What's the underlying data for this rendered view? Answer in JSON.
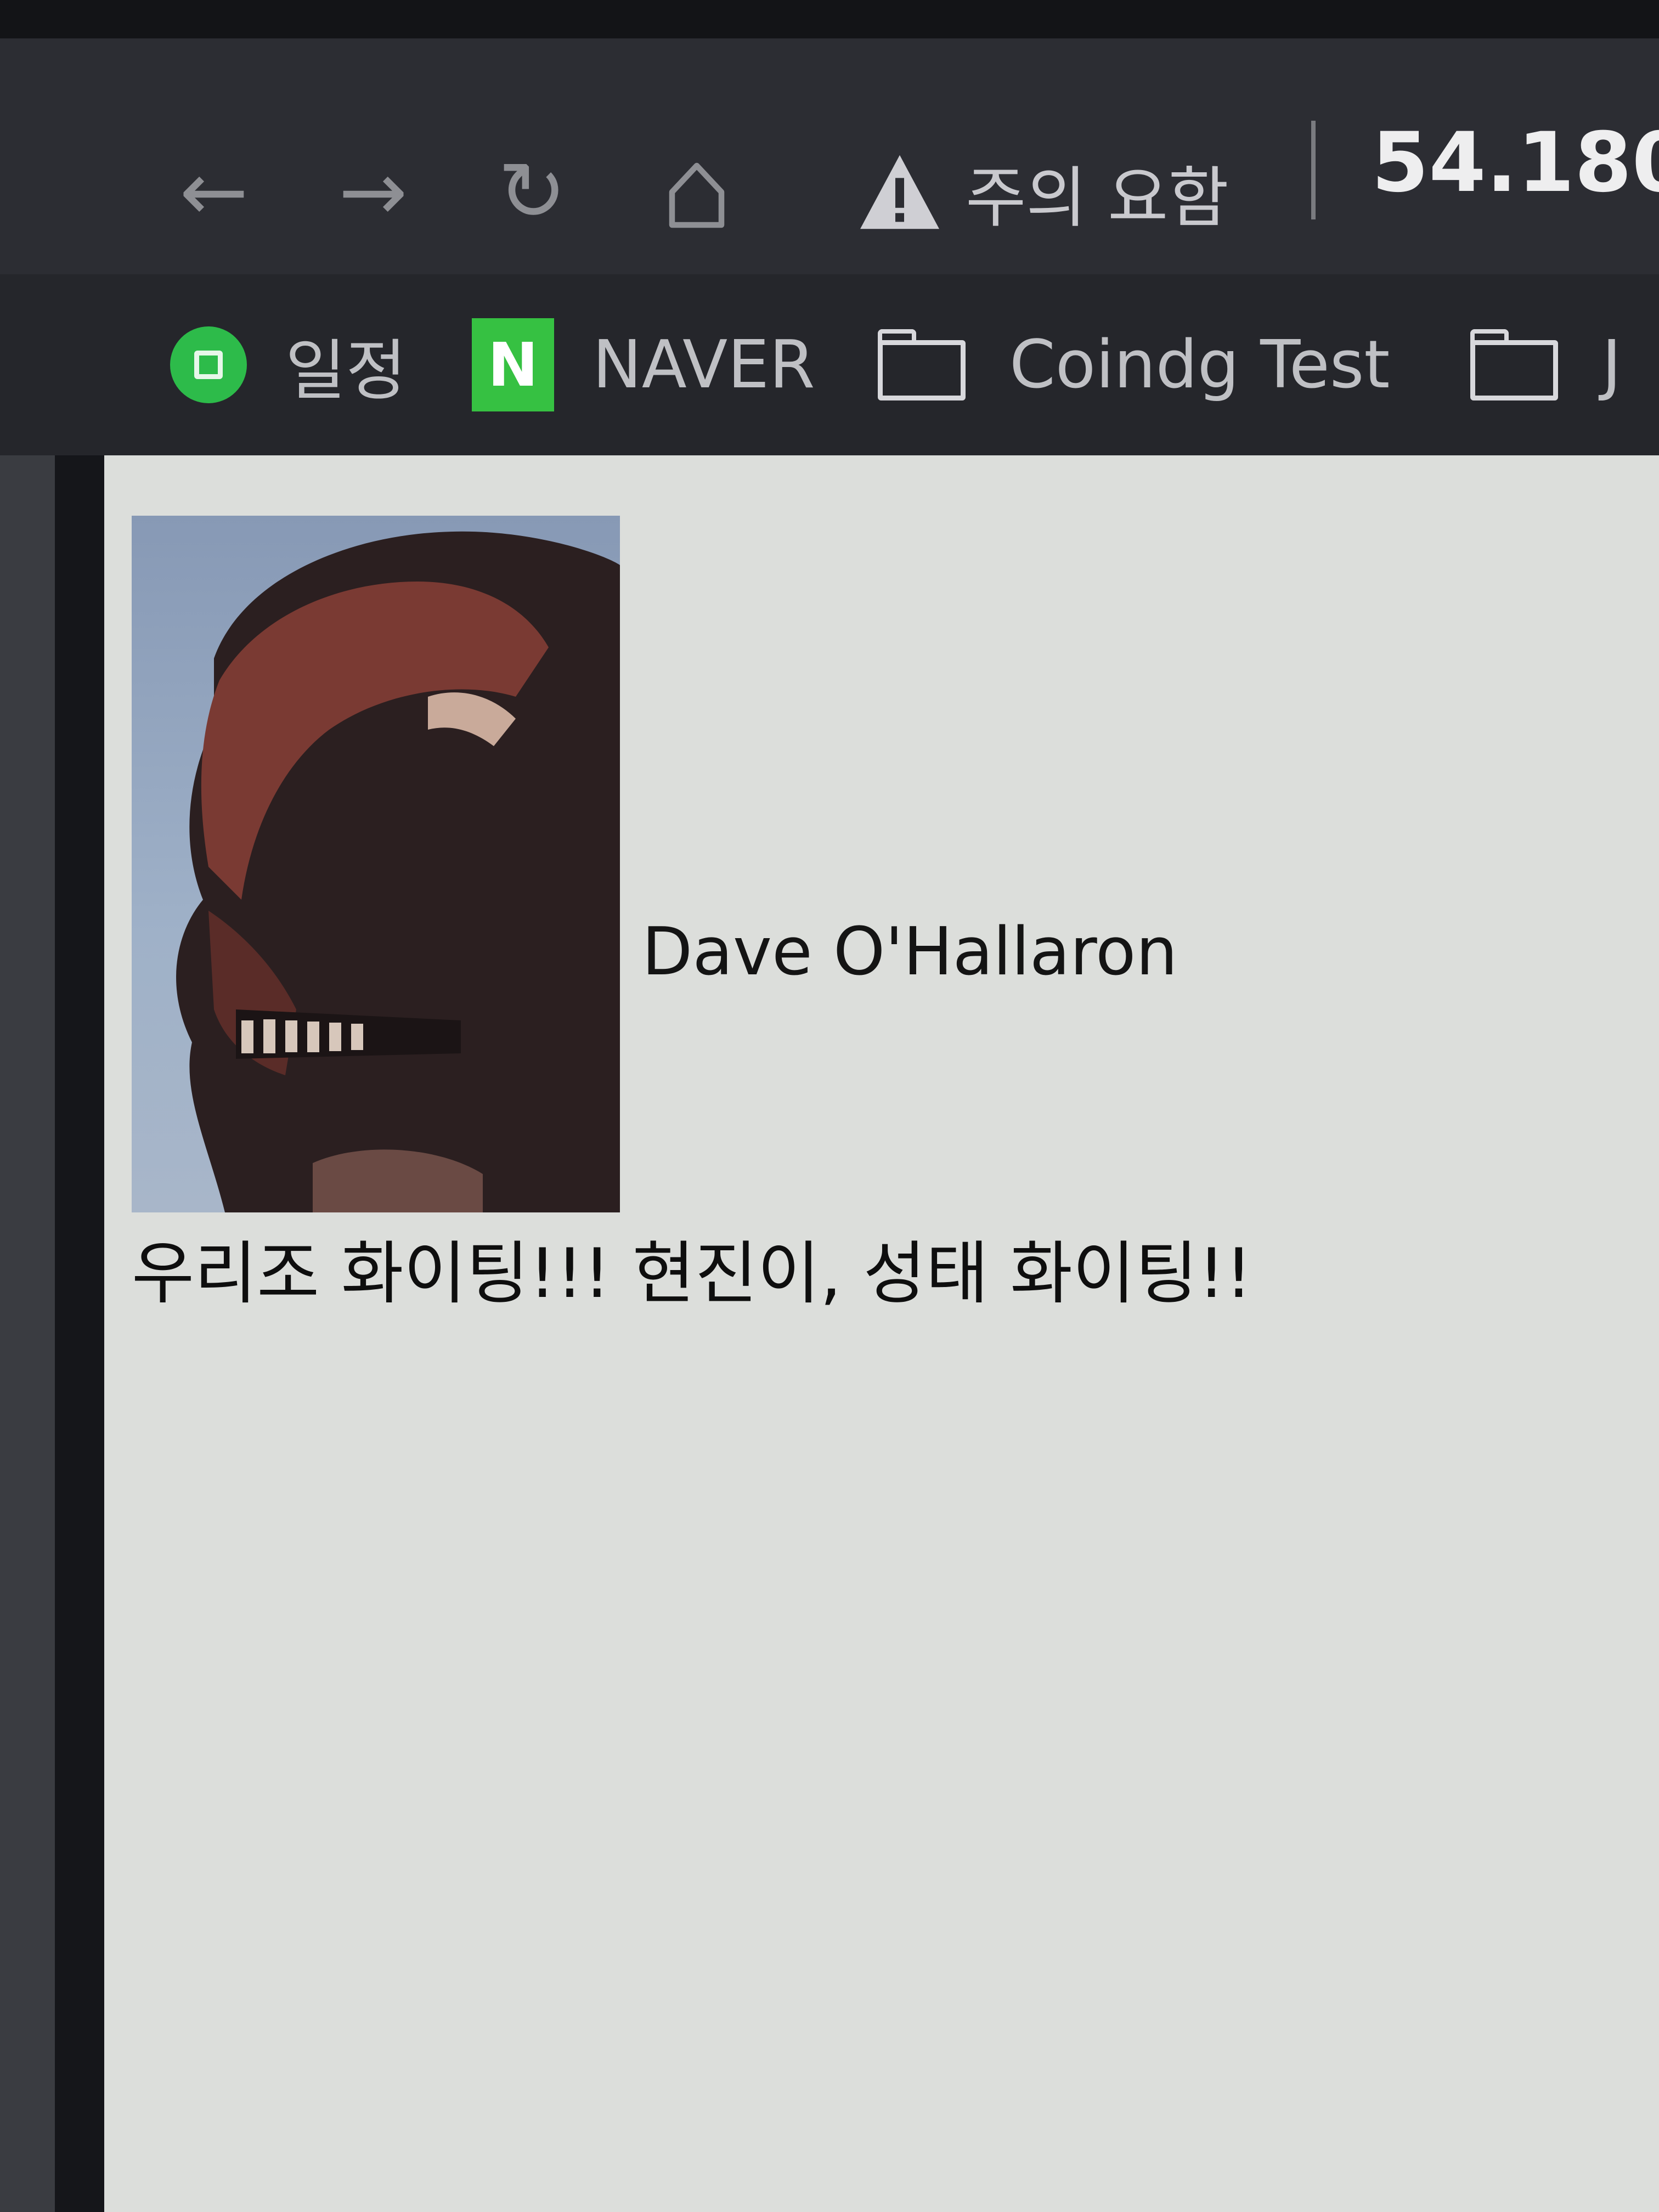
{
  "browser": {
    "nav": {
      "back_icon": "arrow-left-icon",
      "forward_icon": "arrow-right-icon",
      "reload_icon": "reload-icon",
      "home_icon": "home-icon"
    },
    "security_warning": "주의 요함",
    "url": "54.180."
  },
  "bookmarks": [
    {
      "label": "일정",
      "icon": "calendar-icon"
    },
    {
      "label": "NAVER",
      "icon": "naver-icon"
    },
    {
      "label": "Coindg Test",
      "icon": "folder-icon"
    },
    {
      "label": "J",
      "icon": "folder-icon"
    }
  ],
  "page": {
    "photo_icon": "godzilla-photo",
    "name": "Dave O'Hallaron",
    "message": "우리조 화이팅!!! 현진이, 성태 화이팅!!"
  },
  "colors": {
    "toolbar_bg": "#2c2d33",
    "bookmarks_bg": "#25262b",
    "page_bg": "#dcdedb",
    "naver_green": "#36c142",
    "calendar_green": "#2dbb4a"
  }
}
